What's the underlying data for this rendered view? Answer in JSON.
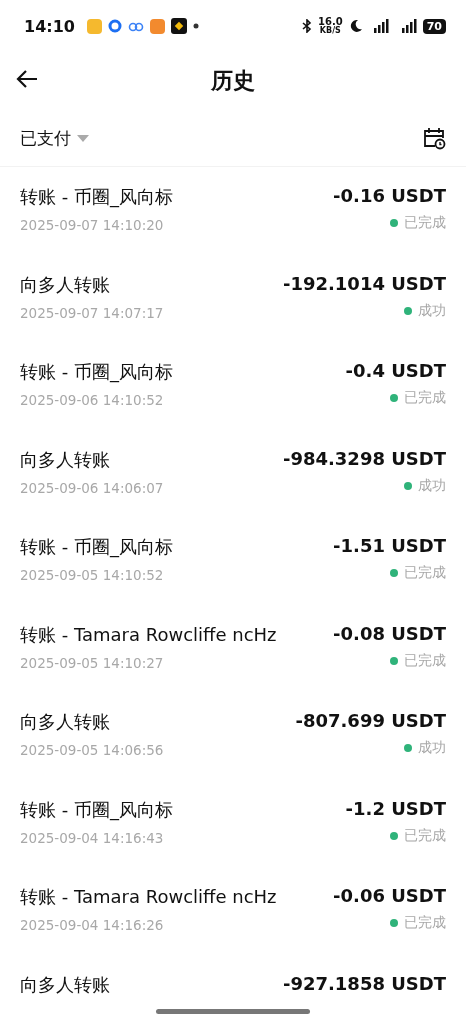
{
  "status_bar": {
    "time": "14:10",
    "speed": "16.0",
    "speed_unit": "KB/S",
    "battery": "70"
  },
  "header": {
    "title": "历史"
  },
  "filter": {
    "label": "已支付"
  },
  "transactions": [
    {
      "title": "转账 - 币圈_风向标",
      "date": "2025-09-07 14:10:20",
      "amount": "-0.16 USDT",
      "status": "已完成"
    },
    {
      "title": "向多人转账",
      "date": "2025-09-07 14:07:17",
      "amount": "-192.1014 USDT",
      "status": "成功"
    },
    {
      "title": "转账 - 币圈_风向标",
      "date": "2025-09-06 14:10:52",
      "amount": "-0.4 USDT",
      "status": "已完成"
    },
    {
      "title": "向多人转账",
      "date": "2025-09-06 14:06:07",
      "amount": "-984.3298 USDT",
      "status": "成功"
    },
    {
      "title": "转账 - 币圈_风向标",
      "date": "2025-09-05 14:10:52",
      "amount": "-1.51 USDT",
      "status": "已完成"
    },
    {
      "title": "转账 - Tamara Rowcliffe ncHz",
      "date": "2025-09-05 14:10:27",
      "amount": "-0.08 USDT",
      "status": "已完成"
    },
    {
      "title": "向多人转账",
      "date": "2025-09-05 14:06:56",
      "amount": "-807.699 USDT",
      "status": "成功"
    },
    {
      "title": "转账 - 币圈_风向标",
      "date": "2025-09-04 14:16:43",
      "amount": "-1.2 USDT",
      "status": "已完成"
    },
    {
      "title": "转账 - Tamara Rowcliffe ncHz",
      "date": "2025-09-04 14:16:26",
      "amount": "-0.06 USDT",
      "status": "已完成"
    },
    {
      "title": "向多人转账",
      "amount": "-927.1858 USDT"
    }
  ]
}
